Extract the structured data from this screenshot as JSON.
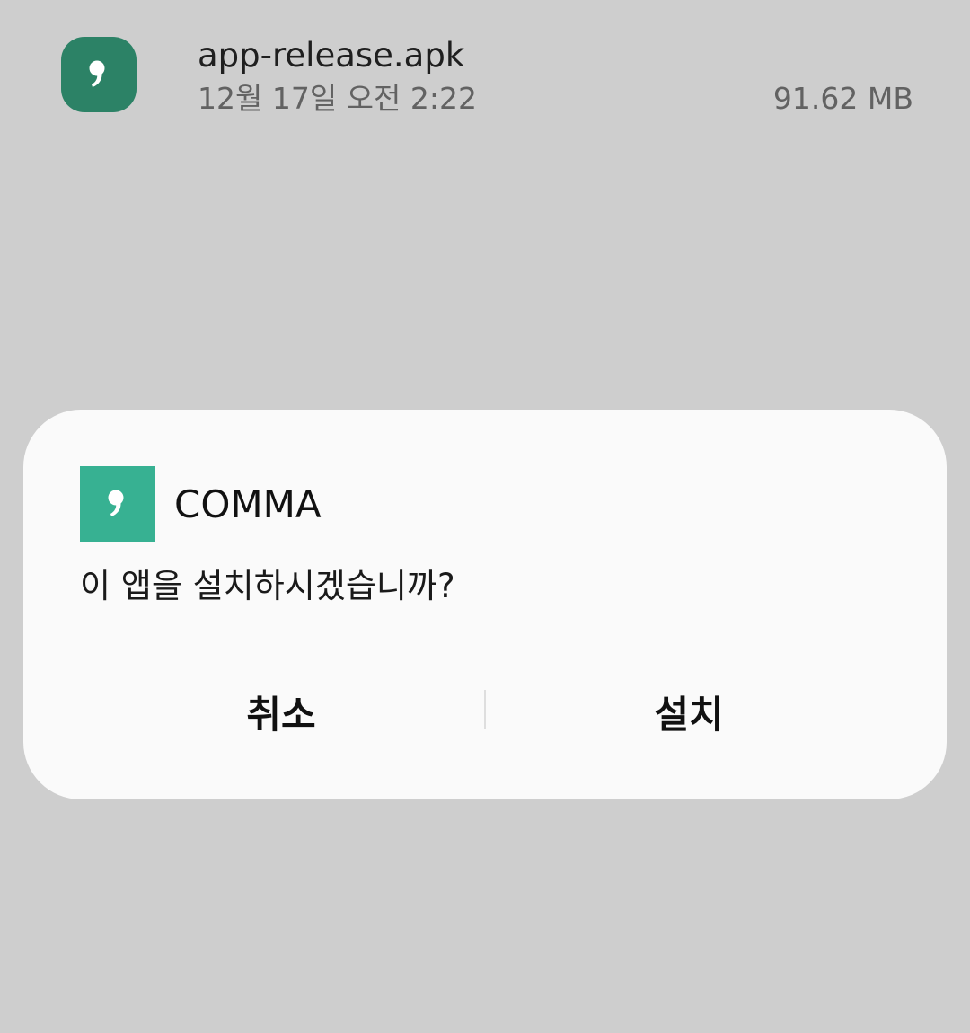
{
  "file": {
    "name": "app-release.apk",
    "date": "12월 17일 오전 2:22",
    "size": "91.62 MB",
    "icon": "comma-app-icon"
  },
  "dialog": {
    "app_name": "COMMA",
    "app_icon": "comma-app-icon",
    "message": "이 앱을 설치하시겠습니까?",
    "cancel_label": "취소",
    "install_label": "설치"
  },
  "colors": {
    "background": "#cecece",
    "dialog": "#fafafa",
    "app_icon": "#37b192",
    "file_icon": "#2c8266"
  }
}
